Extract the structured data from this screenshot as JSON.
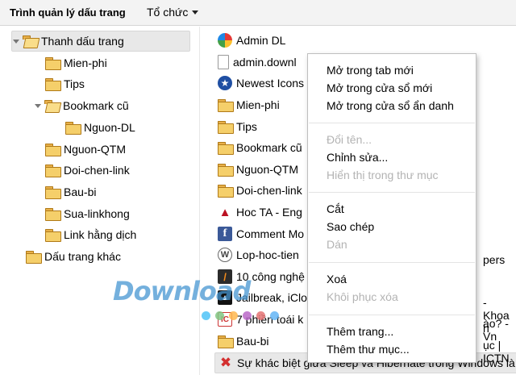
{
  "toolbar": {
    "title": "Trình quản lý dấu trang",
    "organize_label": "Tổ chức"
  },
  "sidebar": {
    "items": [
      {
        "label": "Thanh dấu trang"
      },
      {
        "label": "Mien-phi"
      },
      {
        "label": "Tips"
      },
      {
        "label": "Bookmark cũ"
      },
      {
        "label": "Nguon-DL"
      },
      {
        "label": "Nguon-QTM"
      },
      {
        "label": "Doi-chen-link"
      },
      {
        "label": "Bau-bi"
      },
      {
        "label": "Sua-linkhong"
      },
      {
        "label": "Link hằng dịch"
      },
      {
        "label": "Dấu trang khác"
      }
    ]
  },
  "list": {
    "rows": [
      {
        "label": "Admin DL",
        "icon": "colorful-globe-icon"
      },
      {
        "label": "admin.downl",
        "icon": "document-icon"
      },
      {
        "label": "Newest Icons",
        "icon": "star-icon"
      },
      {
        "label": "Mien-phi",
        "icon": "folder-icon"
      },
      {
        "label": "Tips",
        "icon": "folder-icon"
      },
      {
        "label": "Bookmark cũ",
        "icon": "folder-icon"
      },
      {
        "label": "Nguon-QTM",
        "icon": "folder-icon"
      },
      {
        "label": "Doi-chen-link",
        "icon": "folder-icon"
      },
      {
        "label": "Hoc TA - Eng",
        "icon": "hat-icon"
      },
      {
        "label": "Comment Mo",
        "suffix": "pers",
        "icon": "facebook-icon"
      },
      {
        "label": "Lop-hoc-tien",
        "icon": "wordpress-icon"
      },
      {
        "label": "10 công nghệ",
        "suffix": "- Khoa h",
        "icon": "orange-logo-icon"
      },
      {
        "label": "Jailbreak, iCloud...",
        "suffix": "ào? - Vn",
        "icon": "black-logo-icon"
      },
      {
        "label": "7 phiền toái k",
        "suffix": "ục | ICTN",
        "icon": "ict-logo-icon"
      },
      {
        "label": "Bau-bi",
        "icon": "folder-icon"
      },
      {
        "label": "Sự khác biệt giữa Sleep và Hibernate trong Windows là",
        "icon": "red-x-icon"
      }
    ]
  },
  "context_menu": {
    "group1": [
      "Mở trong tab mới",
      "Mở trong cửa sổ mới",
      "Mở trong cửa sổ ẩn danh"
    ],
    "group2": [
      "Đổi tên...",
      "Chỉnh sửa...",
      "Hiển thị trong thư mục"
    ],
    "group3": [
      "Cắt",
      "Sao chép",
      "Dán"
    ],
    "group4": [
      "Xoá",
      "Khôi phục xóa"
    ],
    "group5": [
      "Thêm trang...",
      "Thêm thư mục..."
    ]
  },
  "watermark": {
    "text": "Download",
    "colors": [
      "#4fc3f7",
      "#81c784",
      "#ffb74d",
      "#ba68c8",
      "#e57373",
      "#64b5f6"
    ]
  }
}
